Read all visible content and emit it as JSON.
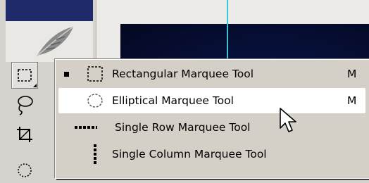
{
  "menu": {
    "items": [
      {
        "label": "Rectangular Marquee Tool",
        "shortcut": "M",
        "selected": true,
        "icon": "rectangular-marquee-icon"
      },
      {
        "label": "Elliptical Marquee Tool",
        "shortcut": "M",
        "selected": false,
        "highlighted": true,
        "icon": "elliptical-marquee-icon"
      },
      {
        "label": "Single Row Marquee Tool",
        "shortcut": "",
        "selected": false,
        "icon": "single-row-marquee-icon"
      },
      {
        "label": "Single Column Marquee Tool",
        "shortcut": "",
        "selected": false,
        "icon": "single-column-marquee-icon"
      }
    ]
  },
  "toolbox": {
    "tools": [
      "marquee-tool-icon",
      "lasso-tool-icon",
      "crop-tool-icon",
      "healing-tool-icon"
    ]
  },
  "colors": {
    "header": "#1f2a6b",
    "menu_background": "#d4d0c8",
    "highlight": "#ffffff",
    "guide": "#36c6d6",
    "document": "#0b1448"
  }
}
